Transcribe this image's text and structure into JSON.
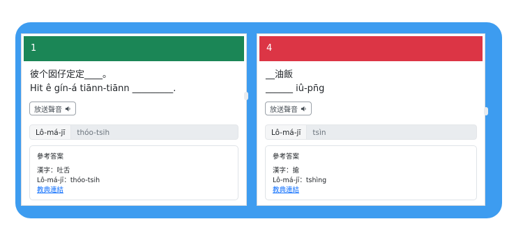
{
  "colors": {
    "frame": "#3d9cf0",
    "card1_header": "#1b8656",
    "card2_header": "#dc3545",
    "link": "#0d6efd"
  },
  "cards": [
    {
      "number": "1",
      "header_color": "#1b8656",
      "prompt_line1": "彼个囡仔定定____。",
      "prompt_line2": "Hit ê gín-á tiānn-tiānn _________.",
      "listen_label": "放送聲音",
      "listen_icon": "speaker-icon",
      "input_label": "Lô-má-jī",
      "input_value": "thóo-tsih",
      "answer_title": "參考答案",
      "answer_hanji": "漢字：吐舌",
      "answer_romanization": "Lô-má-jī：thóo-tsih",
      "answer_link": "教典連結"
    },
    {
      "number": "4",
      "header_color": "#dc3545",
      "prompt_line1": "__油飯",
      "prompt_line2": "______ iû-pn̄g",
      "listen_label": "放送聲音",
      "listen_icon": "speaker-icon",
      "input_label": "Lô-má-jī",
      "input_value": "tsìn",
      "answer_title": "參考答案",
      "answer_hanji": "漢字：搶",
      "answer_romanization": "Lô-má-jī：tshìng",
      "answer_link": "教典連結"
    }
  ]
}
